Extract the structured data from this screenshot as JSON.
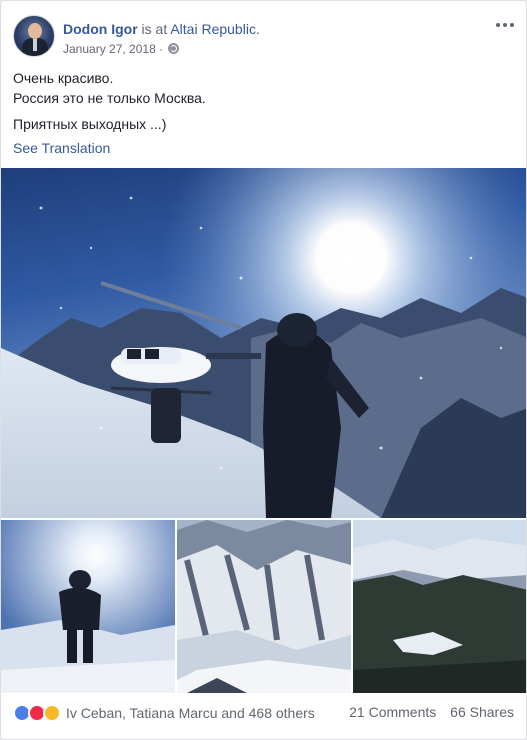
{
  "post": {
    "author": "Dodon Igor",
    "is_at": " is at ",
    "location": "Altai Republic.",
    "date": "January 27, 2018 ·",
    "privacy_icon": "globe-icon",
    "more_icon": "ellipsis-icon",
    "text_lines": [
      "Очень красиво.",
      "Россия это не только Москва.",
      "Приятных выходных ...)"
    ],
    "see_translation": "See Translation"
  },
  "photos": {
    "main": "helicopter-mountain-photo",
    "thumbnails": [
      "hiker-snow-photo",
      "mountain-ridge-photo",
      "forest-valley-photo"
    ]
  },
  "footer": {
    "reaction_icons": [
      "like-icon",
      "love-icon",
      "wow-icon"
    ],
    "reaction_names": "Iv Ceban, Tatiana Marcu and 468 others",
    "comments": "21 Comments",
    "shares": "66 Shares"
  },
  "colors": {
    "link": "#365899",
    "meta": "#616770",
    "like": "#4a7ee6",
    "love": "#f0284a",
    "wow": "#f7b928"
  }
}
